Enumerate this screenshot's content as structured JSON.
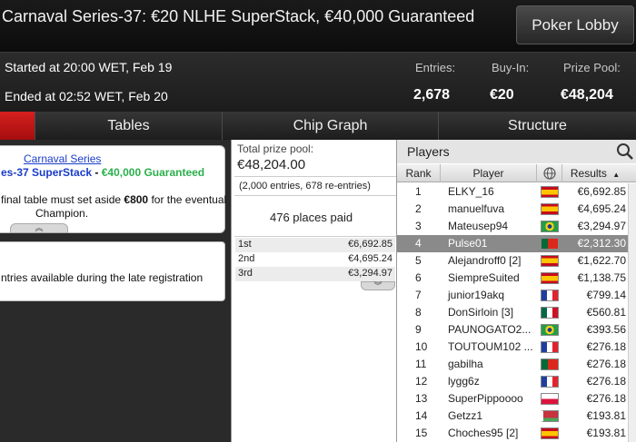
{
  "window": {
    "title": "Carnaval Series-37: €20 NLHE SuperStack, €40,000 Guaranteed",
    "lobby_button": "Poker Lobby"
  },
  "info": {
    "started": "Started at 20:00 WET, Feb 19",
    "ended": "Ended at 02:52 WET, Feb 20",
    "entries_label": "Entries:",
    "entries_value": "2,678",
    "buyin_label": "Buy-In:",
    "buyin_value": "€20",
    "pool_label": "Prize Pool:",
    "pool_value": "€48,204"
  },
  "tabs": [
    "",
    "Tables",
    "Chip Graph",
    "Structure"
  ],
  "left": {
    "link": "Carnaval Series",
    "subtitle_a": "es-37 SuperStack",
    "subtitle_sep": " - ",
    "subtitle_b": "€40,000 Guaranteed",
    "note_a": "final table must set aside ",
    "note_bold": "€800",
    "note_b": " for the eventual",
    "note_c": "Champion.",
    "entries_note": "ntries available during the late registration"
  },
  "prize": {
    "total_label": "Total prize pool:",
    "total_value": "€48,204.00",
    "entries_detail": "(2,000 entries, 678 re-entries)",
    "places_paid": "476 places paid",
    "rows": [
      {
        "place": "1st",
        "amount": "€6,692.85"
      },
      {
        "place": "2nd",
        "amount": "€4,695.24"
      },
      {
        "place": "3rd",
        "amount": "€3,294.97"
      }
    ]
  },
  "players": {
    "title": "Players",
    "columns": {
      "rank": "Rank",
      "player": "Player",
      "results": "Results"
    },
    "rows": [
      {
        "rank": "1",
        "name": "ELKY_16",
        "flag": "spain",
        "result": "€6,692.85"
      },
      {
        "rank": "2",
        "name": "manuelfuva",
        "flag": "spain",
        "result": "€4,695.24"
      },
      {
        "rank": "3",
        "name": "Mateusep94",
        "flag": "brazil",
        "result": "€3,294.97"
      },
      {
        "rank": "4",
        "name": "Pulse01",
        "flag": "portugal",
        "result": "€2,312.30"
      },
      {
        "rank": "5",
        "name": "Alejandroff0 [2]",
        "flag": "spain",
        "result": "€1,622.70"
      },
      {
        "rank": "6",
        "name": "SiempreSuited",
        "flag": "spain",
        "result": "€1,138.75"
      },
      {
        "rank": "7",
        "name": "junior19akq",
        "flag": "france",
        "result": "€799.14"
      },
      {
        "rank": "8",
        "name": "DonSirloin [3]",
        "flag": "mexico",
        "result": "€560.81"
      },
      {
        "rank": "9",
        "name": "PAUNOGATO2...",
        "flag": "brazil",
        "result": "€393.56"
      },
      {
        "rank": "10",
        "name": "TOUTOUM102 ...",
        "flag": "france",
        "result": "€276.18"
      },
      {
        "rank": "11",
        "name": "gabilha",
        "flag": "portugal",
        "result": "€276.18"
      },
      {
        "rank": "12",
        "name": "lygg6z",
        "flag": "france",
        "result": "€276.18"
      },
      {
        "rank": "13",
        "name": "SuperPippoooo",
        "flag": "poland",
        "result": "€276.18"
      },
      {
        "rank": "14",
        "name": "Getzz1",
        "flag": "belarus",
        "result": "€193.81"
      },
      {
        "rank": "15",
        "name": "Choches95 [2]",
        "flag": "spain",
        "result": "€193.81"
      }
    ]
  }
}
